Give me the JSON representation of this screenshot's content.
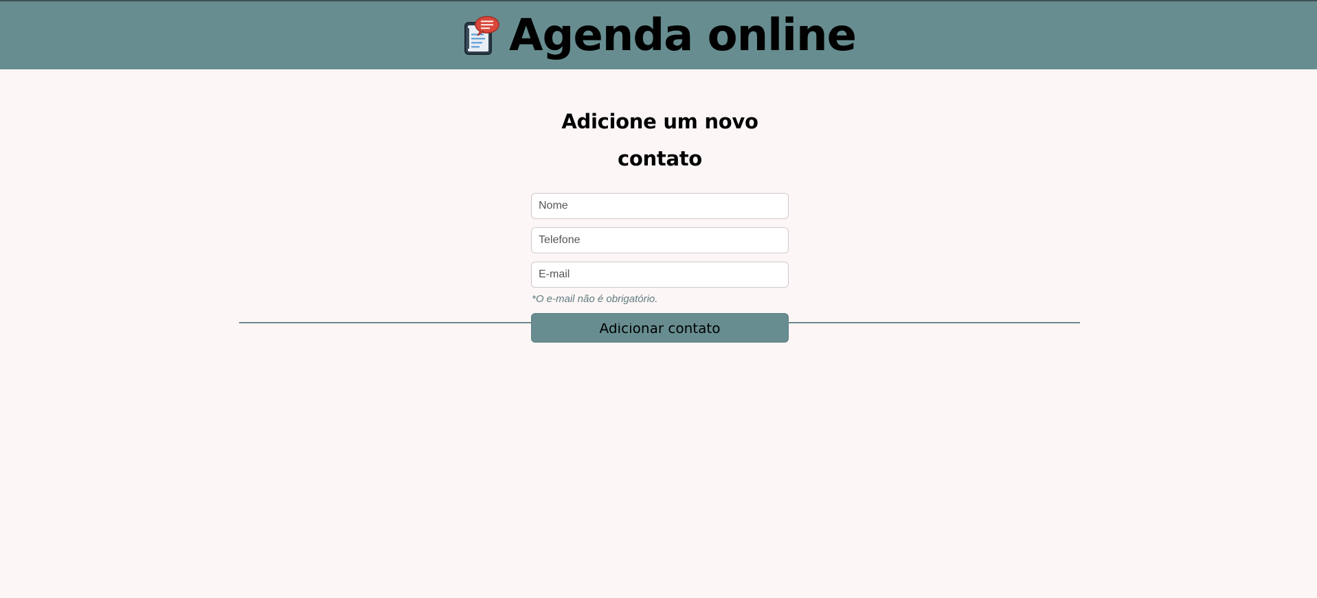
{
  "header": {
    "title": "Agenda online",
    "logo_icon": "phone-book-icon"
  },
  "form": {
    "title": "Adicione um novo contato",
    "fields": {
      "nome": {
        "placeholder": "Nome",
        "value": ""
      },
      "telefone": {
        "placeholder": "Telefone",
        "value": ""
      },
      "email": {
        "placeholder": "E-mail",
        "value": ""
      }
    },
    "email_hint": "*O e-mail não é obrigatório.",
    "submit_label": "Adicionar contato"
  },
  "colors": {
    "header_bg": "#678d90",
    "page_bg": "#fdf6f6",
    "button_bg": "#678d90",
    "hint_text": "#5e7b7e",
    "divider": "#6b8a8d"
  }
}
